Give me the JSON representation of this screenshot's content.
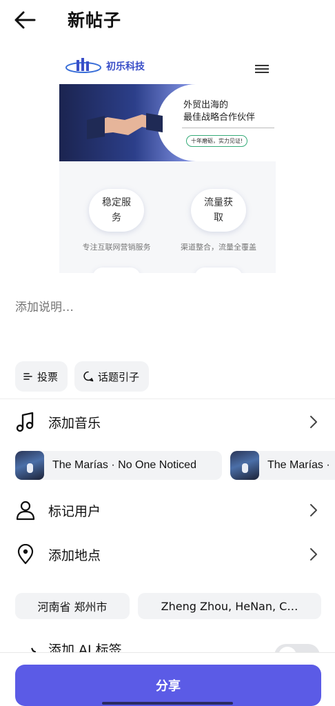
{
  "header": {
    "title": "新帖子",
    "back_icon": "arrow-left-icon"
  },
  "preview": {
    "brand_name": "初乐科技",
    "menu_icon": "hamburger-menu-icon",
    "banner_line1": "外贸出海的",
    "banner_line2": "最佳战略合作伙伴",
    "banner_badge": "十年磨砺，实力见证!",
    "features": [
      {
        "title": "稳定服务",
        "desc": "专注互联网营销服务"
      },
      {
        "title": "流量获取",
        "desc": "渠道整合，流量全覆盖"
      }
    ]
  },
  "caption": {
    "placeholder": "添加说明…"
  },
  "chips": {
    "poll": "投票",
    "topic": "话题引子"
  },
  "rows": {
    "music": "添加音乐",
    "tag_people": "标记用户",
    "location": "添加地点",
    "ai_label": "添加 AI 标签"
  },
  "music_suggestions": [
    {
      "text": "The Marías · No One Noticed"
    },
    {
      "text": "The Marías ·"
    }
  ],
  "location_suggestions": [
    {
      "text": "河南省 郑州市"
    },
    {
      "text": "Zheng Zhou, HeNan, C…"
    }
  ],
  "share": {
    "label": "分享"
  },
  "colors": {
    "accent": "#5b5be6",
    "chip_bg": "#f2f3f5"
  }
}
